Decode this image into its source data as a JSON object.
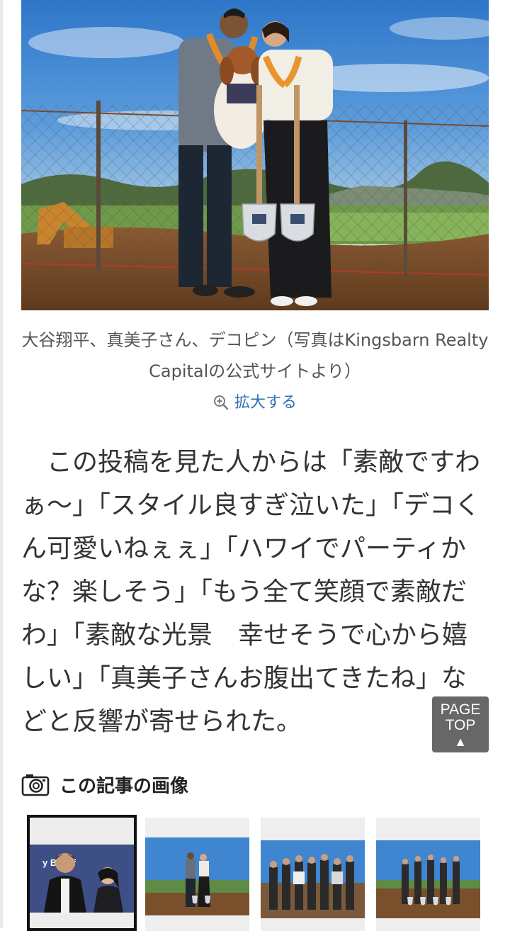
{
  "photo": {
    "alt": "Ground-breaking ceremony photo: couple holding a dog and two shovels in front of a fence",
    "shovel_badge_text": "KINGSBARN"
  },
  "caption": {
    "text": "大谷翔平、真美子さん、デコピン（写真はKingsbarn Realty Capitalの公式サイトより）"
  },
  "enlarge": {
    "icon": "zoom-in-icon",
    "label": "拡大する"
  },
  "article": {
    "paragraph": "この投稿を見た人からは「素敵ですわぁ〜」「スタイル良すぎ泣いた」「デコくん可愛いねぇぇ」「ハワイでパーティかな？楽しそう」「もう全て笑顔で素敵だわ」「素敵な光景　幸せそうで心から嬉しい」「真美子さんお腹出てきたね」などと反響が寄せられた。"
  },
  "page_top": {
    "line1": "PAGE",
    "line2": "TOP",
    "arrow": "▲"
  },
  "images_section": {
    "icon": "camera-icon",
    "title": "この記事の画像"
  },
  "thumbnails": [
    {
      "label": "thumbnail-1",
      "banner_text": "y Benef",
      "selected": true
    },
    {
      "label": "thumbnail-2",
      "selected": false
    },
    {
      "label": "thumbnail-3",
      "selected": false
    },
    {
      "label": "thumbnail-4",
      "selected": false
    }
  ],
  "colors": {
    "link": "#2f6fb5",
    "text": "#333333",
    "page_top_bg": "#5a5a5a",
    "thumb_selected_border": "#111111"
  }
}
